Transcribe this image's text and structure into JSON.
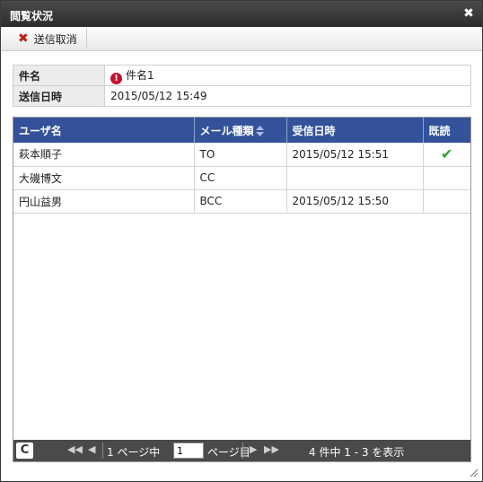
{
  "dialog": {
    "title": "閲覧状況",
    "close_glyph": "✖",
    "toolbar": {
      "cancel_label": "送信取消"
    },
    "info": {
      "subject_key": "件名",
      "subject_value": "件名1",
      "sent_key": "送信日時",
      "sent_value": "2015/05/12 15:49"
    },
    "grid": {
      "headers": [
        "ユーザ名",
        "メール種類",
        "受信日時",
        "既読"
      ],
      "rows": [
        {
          "user": "萩本順子",
          "type": "TO",
          "received": "2015/05/12 15:51",
          "read": "✔"
        },
        {
          "user": "大磯博文",
          "type": "CC",
          "received": "",
          "read": ""
        },
        {
          "user": "円山益男",
          "type": "BCC",
          "received": "2015/05/12 15:50",
          "read": ""
        }
      ]
    },
    "pager": {
      "refresh_glyph": "C",
      "first": "◀◀",
      "prev": "◀",
      "next": "▶",
      "last": "▶▶",
      "page_prefix": "1 ページ中",
      "page_value": "1",
      "page_suffix": "ページ目",
      "summary": "4 件中 1 - 3 を表示"
    }
  },
  "colors": {
    "header_blue": "#33529a",
    "titlebar": "#333333",
    "danger": "#c21a1a",
    "check": "#2aa62a"
  }
}
